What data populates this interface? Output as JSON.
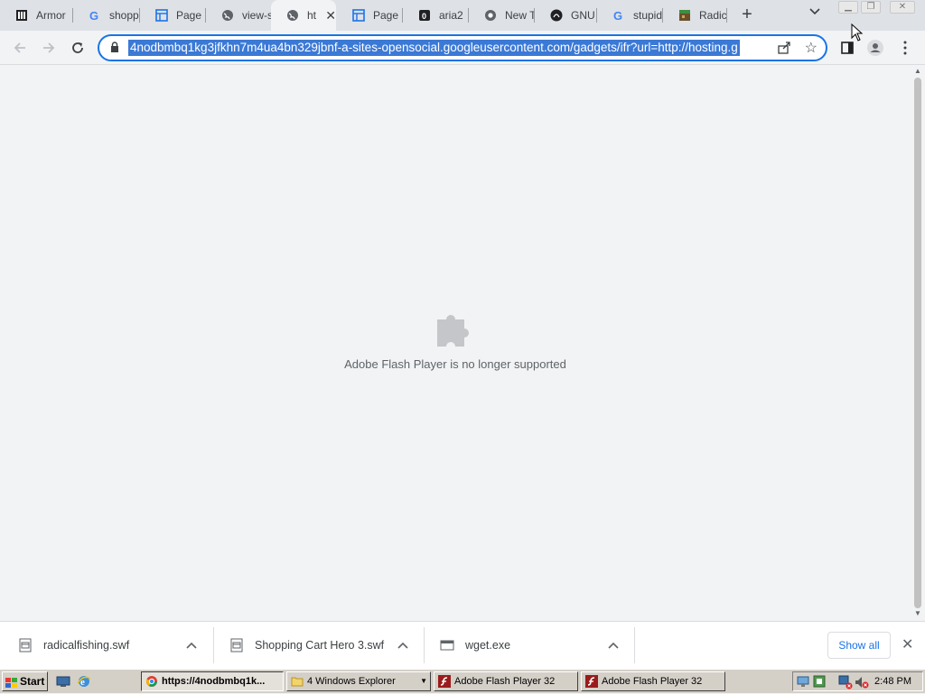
{
  "browser": {
    "tabs": [
      {
        "label": "Armor",
        "icon": "archive-icon"
      },
      {
        "label": "shopp",
        "icon": "google-icon"
      },
      {
        "label": "Page n",
        "icon": "page-icon"
      },
      {
        "label": "view-s",
        "icon": "globe-icon"
      },
      {
        "label": "htt",
        "icon": "globe-icon",
        "active": true
      },
      {
        "label": "Page r",
        "icon": "page-icon"
      },
      {
        "label": "aria2",
        "icon": "github-icon"
      },
      {
        "label": "New T",
        "icon": "chrome-icon"
      },
      {
        "label": "GNU V",
        "icon": "gnu-icon"
      },
      {
        "label": "stupid",
        "icon": "google-icon"
      },
      {
        "label": "Radica",
        "icon": "game-icon"
      }
    ],
    "url": "4nodbmbq1kg3jfkhn7m4ua4bn329jbnf-a-sites-opensocial.googleusercontent.com/gadgets/ifr?url=http://hosting.g"
  },
  "page": {
    "message": "Adobe Flash Player is no longer supported"
  },
  "downloads": {
    "items": [
      {
        "name": "radicalfishing.swf"
      },
      {
        "name": "Shopping Cart Hero 3.swf"
      },
      {
        "name": "wget.exe"
      }
    ],
    "show_all": "Show all"
  },
  "taskbar": {
    "start": "Start",
    "buttons": [
      {
        "label": "https://4nodbmbq1k..."
      },
      {
        "label": "4 Windows Explorer"
      },
      {
        "label": "Adobe Flash Player 32"
      },
      {
        "label": "Adobe Flash Player 32"
      }
    ],
    "clock": "2:48 PM"
  },
  "colors": {
    "accent": "#1a73e8",
    "selection": "#3b79d6",
    "flash_red": "#9b1c1c"
  }
}
